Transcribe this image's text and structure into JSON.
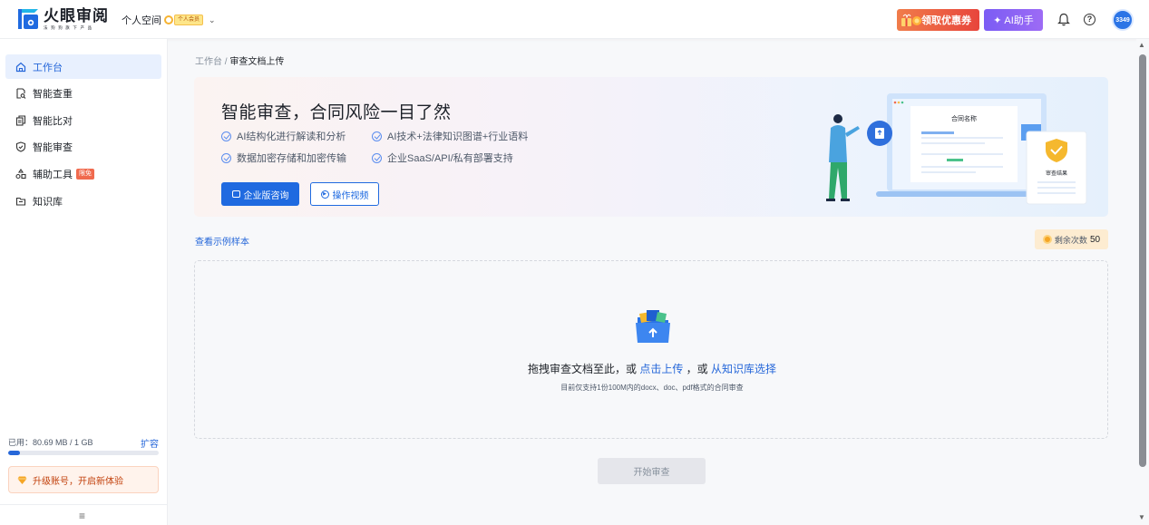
{
  "header": {
    "logo_title": "火眼审阅",
    "logo_sub": "法狗狗旗下产品",
    "space_label": "个人空间",
    "member_badge": "个人会员",
    "coupon_label": "领取优惠券",
    "ai_label": "AI助手",
    "avatar_text": "3349"
  },
  "sidebar": {
    "items": [
      {
        "label": "工作台",
        "icon": "home-icon",
        "active": true
      },
      {
        "label": "智能查重",
        "icon": "doc-search-icon"
      },
      {
        "label": "智能比对",
        "icon": "compare-icon"
      },
      {
        "label": "智能审查",
        "icon": "shield-check-icon"
      },
      {
        "label": "辅助工具",
        "icon": "tools-icon",
        "badge": "限免"
      },
      {
        "label": "知识库",
        "icon": "folder-icon"
      }
    ],
    "storage_used": "已用：80.69 MB / 1 GB",
    "storage_expand": "扩容",
    "storage_fraction": 0.079,
    "upgrade_label": "升级账号，开启新体验"
  },
  "breadcrumb": {
    "root": "工作台",
    "separator": " / ",
    "current": "审查文档上传"
  },
  "banner": {
    "title": "智能审查，合同风险一目了然",
    "features": [
      "AI结构化进行解读和分析",
      "AI技术+法律知识图谱+行业语料",
      "数据加密存储和加密传输",
      "企业SaaS/API/私有部署支持"
    ],
    "primary_btn": "企业版咨询",
    "secondary_btn": "操作视频",
    "illus_contract": "合同名称",
    "illus_result": "审查结果"
  },
  "main": {
    "sample_link": "查看示例样本",
    "remain_label": "剩余次数",
    "remain_count": "50",
    "drop_prefix": "拖拽审查文档至此，或 ",
    "drop_click": "点击上传",
    "drop_mid": " ，或 ",
    "drop_kb": "从知识库选择",
    "drop_hint": "目前仅支持1份100M内的docx、doc、pdf格式的合同审查",
    "start_btn": "开始审查"
  },
  "colors": {
    "primary": "#1f6ae0",
    "active_bg": "#e8f0fe",
    "coupon": "#e8453c",
    "ai": "#8b62f5"
  }
}
